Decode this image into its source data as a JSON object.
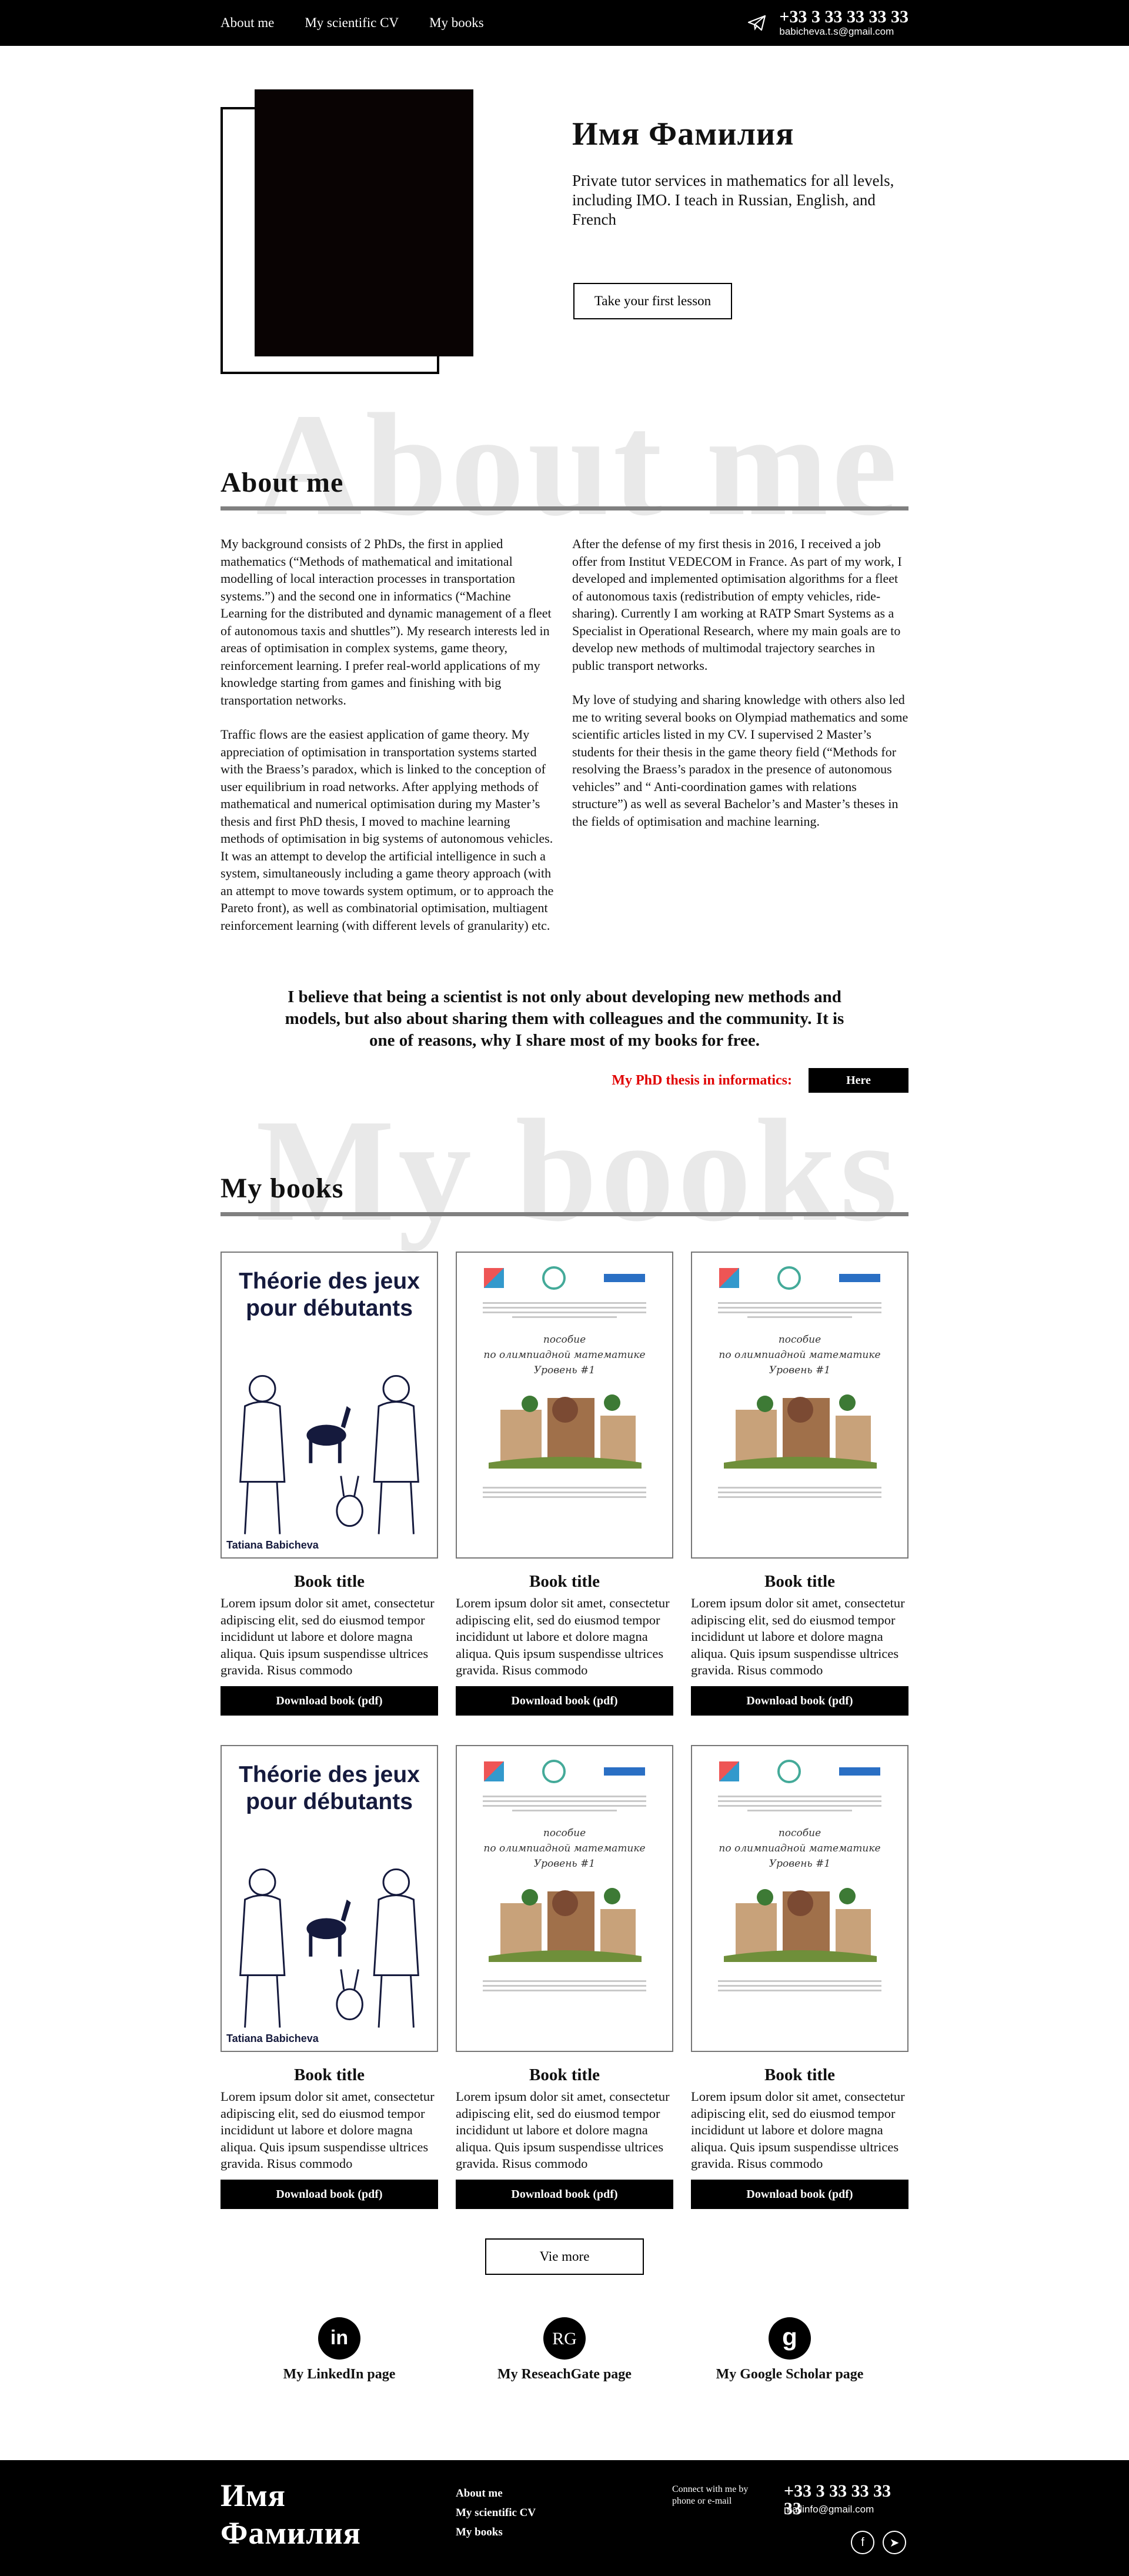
{
  "header": {
    "nav": [
      "About me",
      "My scientific CV",
      "My books"
    ],
    "phone": "+33 3 33 33 33 33",
    "email": "babicheva.t.s@gmail.com",
    "telegram_icon": "paper-plane-icon"
  },
  "hero": {
    "name": "Имя Фамилия",
    "description": "Private tutor services in mathematics for all levels, including IMO. I teach in Russian, English, and French",
    "cta": "Take your first lesson"
  },
  "about": {
    "ghost": "About me",
    "title": "About me",
    "left": [
      "My background consists of 2 PhDs, the first in applied mathematics (“Methods of mathematical and imitational modelling of local interaction processes in transportation systems.”) and the second one in informatics (“Machine Learning for the distributed and dynamic management of a fleet of autonomous taxis and shuttles”). My research interests led in areas of optimisation in complex systems, game theory, reinforcement learning. I prefer real-world applications of my knowledge starting from games and finishing with big transportation networks.",
      "Traffic flows are the easiest application of game theory. My appreciation of optimisation in transportation systems started with the Braess’s paradox, which is linked to the conception of user equilibrium in road networks. After applying methods of mathematical and numerical optimisation during my Master’s thesis and first PhD thesis, I moved to machine learning methods of optimisation in big systems of autonomous vehicles. It was an attempt to develop the artificial intelligence in such a system, simultaneously including a game theory approach (with an attempt to move towards system optimum, or to approach the Pareto front), as well as combinatorial optimisation, multiagent reinforcement learning (with different levels of granularity) etc."
    ],
    "right": [
      "After the defense of my first thesis in 2016, I received a job offer from Institut VEDECOM in France. As part of my work, I developed and implemented optimisation algorithms for a fleet of autonomous taxis (redistribution of empty vehicles, ride-sharing). Currently I am working at RATP Smart Systems as a Specialist in Operational Research, where my main goals are to develop new methods of multimodal trajectory searches in public transport networks.",
      "My love of studying and sharing knowledge with others also led me to writing several books on Olympiad mathematics and some scientific articles listed in my CV. I supervised 2 Master’s students for their thesis in the game theory field (“Methods for resolving the Braess’s paradox in the presence of autonomous vehicles” and “ Anti-coordination games with relations structure”) as well as several Bachelor’s and Master’s theses in the fields of optimisation and machine learning."
    ],
    "quote": "I believe that being a scientist is not only about developing new methods and models, but also about sharing them with colleagues and the community. It is one of reasons, why I share most of my books for free.",
    "thesis_label": "My PhD thesis in informatics:",
    "thesis_button": "Here"
  },
  "books": {
    "ghost": "My books",
    "title": "My books",
    "items": [
      {
        "cover": "fr",
        "cover_title": "Théorie des jeux pour débutants",
        "cover_author": "Tatiana Babicheva",
        "title": "Book title",
        "desc": "Lorem ipsum dolor sit amet, consectetur adipiscing elit, sed do eiusmod tempor incididunt ut labore et dolore magna aliqua. Quis ipsum suspendisse ultrices gravida. Risus commodo",
        "button": "Download book (pdf)"
      },
      {
        "cover": "ru",
        "cover_line1": "пособие",
        "cover_line2": "по олимпиадной математике",
        "cover_line3": "Уровень #1",
        "title": "Book title",
        "desc": "Lorem ipsum dolor sit amet, consectetur adipiscing elit, sed do eiusmod tempor incididunt ut labore et dolore magna aliqua. Quis ipsum suspendisse ultrices gravida. Risus commodo",
        "button": "Download book (pdf)"
      },
      {
        "cover": "ru",
        "cover_line1": "пособие",
        "cover_line2": "по олимпиадной математике",
        "cover_line3": "Уровень #1",
        "title": "Book title",
        "desc": "Lorem ipsum dolor sit amet, consectetur adipiscing elit, sed do eiusmod tempor incididunt ut labore et dolore magna aliqua. Quis ipsum suspendisse ultrices gravida. Risus commodo",
        "button": "Download book (pdf)"
      },
      {
        "cover": "fr",
        "cover_title": "Théorie des jeux pour débutants",
        "cover_author": "Tatiana Babicheva",
        "title": "Book title",
        "desc": "Lorem ipsum dolor sit amet, consectetur adipiscing elit, sed do eiusmod tempor incididunt ut labore et dolore magna aliqua. Quis ipsum suspendisse ultrices gravida. Risus commodo",
        "button": "Download book (pdf)"
      },
      {
        "cover": "ru",
        "cover_line1": "пособие",
        "cover_line2": "по олимпиадной математике",
        "cover_line3": "Уровень #1",
        "title": "Book title",
        "desc": "Lorem ipsum dolor sit amet, consectetur adipiscing elit, sed do eiusmod tempor incididunt ut labore et dolore magna aliqua. Quis ipsum suspendisse ultrices gravida. Risus commodo",
        "button": "Download book (pdf)"
      },
      {
        "cover": "ru",
        "cover_line1": "пособие",
        "cover_line2": "по олимпиадной математике",
        "cover_line3": "Уровень #1",
        "title": "Book title",
        "desc": "Lorem ipsum dolor sit amet, consectetur adipiscing elit, sed do eiusmod tempor incididunt ut labore et dolore magna aliqua. Quis ipsum suspendisse ultrices gravida. Risus commodo",
        "button": "Download book (pdf)"
      }
    ],
    "more": "Vie more"
  },
  "profiles": [
    {
      "icon": "linkedin-icon",
      "glyph": "in",
      "label": "My LinkedIn page"
    },
    {
      "icon": "researchgate-icon",
      "glyph": "RG",
      "label": "My ReseachGate page"
    },
    {
      "icon": "google-scholar-icon",
      "glyph": "g",
      "label": "My Google Scholar page"
    }
  ],
  "footer": {
    "name": "Имя Фамилия",
    "nav": [
      "About me",
      "My scientific CV",
      "My books"
    ],
    "connect": "Connect with me by phone or e-mail",
    "phone": "+33 3 33 33 33 33",
    "email": "mailinfo@gmail.com",
    "social": [
      {
        "icon": "facebook-icon",
        "glyph": "f"
      },
      {
        "icon": "telegram-icon",
        "glyph": "➤"
      }
    ]
  },
  "colors": {
    "accent_red": "#e00000",
    "dark": "#000000",
    "rule": "#808080",
    "ghost": "#e9e9e9"
  }
}
